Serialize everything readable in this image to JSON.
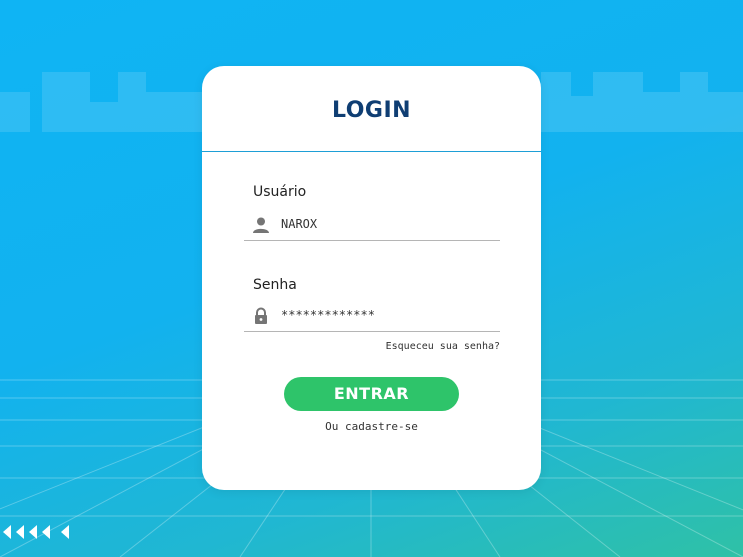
{
  "login": {
    "title": "LOGIN",
    "username_label": "Usuário",
    "username_value": "NAROX",
    "password_label": "Senha",
    "password_value": "*************",
    "forgot_link": "Esqueceu sua senha?",
    "submit_label": "ENTRAR",
    "register_link": "Ou cadastre-se"
  },
  "icons": {
    "username": "user-icon",
    "password": "lock-icon",
    "back": "back-arrows-icon"
  },
  "colors": {
    "title": "#0f3e73",
    "button": "#2ec46a",
    "divider": "#1e9fd6"
  }
}
